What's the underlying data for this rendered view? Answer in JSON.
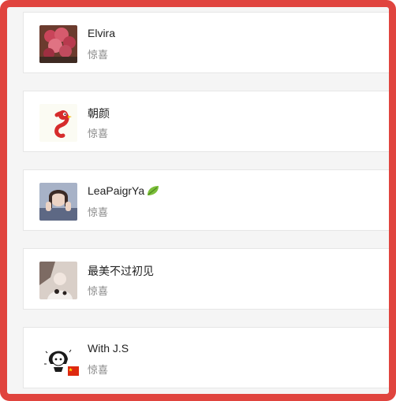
{
  "contacts": [
    {
      "name": "Elvira",
      "subtitle": "惊喜",
      "avatar_icon": "flowers-avatar-icon"
    },
    {
      "name": "朝颜",
      "subtitle": "惊喜",
      "avatar_icon": "cartoon-bird-avatar-icon"
    },
    {
      "name": "LeaPaigrYa",
      "subtitle": "惊喜",
      "avatar_icon": "girl-photo-avatar-icon",
      "badge_icon": "leaf-emoji-icon"
    },
    {
      "name": "最美不过初见",
      "subtitle": "惊喜",
      "avatar_icon": "girl-sketch-avatar-icon"
    },
    {
      "name": "With J.S",
      "subtitle": "惊喜",
      "avatar_icon": "anime-girl-avatar-icon",
      "badge_icon": "china-flag-icon"
    }
  ],
  "colors": {
    "frame": "#e0443e",
    "name": "#222222",
    "subtitle": "#888888"
  }
}
